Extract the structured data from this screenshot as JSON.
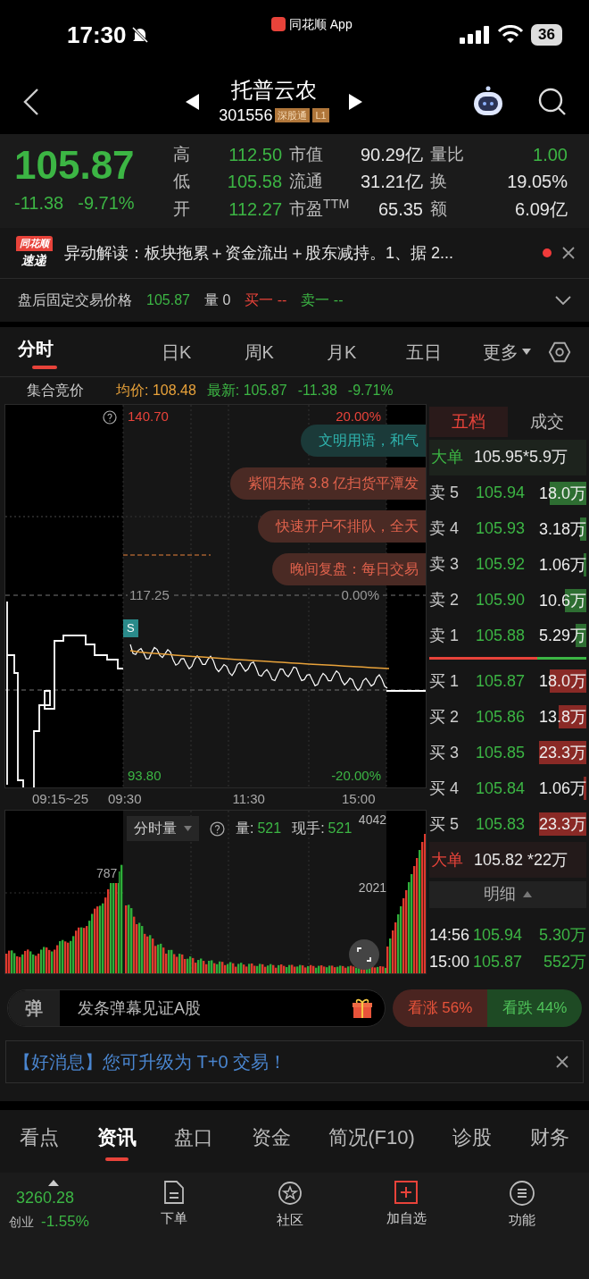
{
  "status_bar": {
    "time": "17:30",
    "app_label": "同花顺 App",
    "battery": "36",
    "muted": true
  },
  "header": {
    "name": "托普云农",
    "code": "301556",
    "tags": [
      "深股通",
      "L1"
    ]
  },
  "quote": {
    "price": "105.87",
    "change": "-11.38",
    "change_pct": "-9.71%",
    "stats": [
      {
        "label": "高",
        "value": "112.50",
        "color": "#3cb544"
      },
      {
        "label": "市值",
        "value": "90.29亿",
        "color": "#e6e6e6"
      },
      {
        "label": "量比",
        "value": "1.00",
        "color": "#3cb544"
      },
      {
        "label": "低",
        "value": "105.58",
        "color": "#3cb544"
      },
      {
        "label": "流通",
        "value": "31.21亿",
        "color": "#e6e6e6"
      },
      {
        "label": "换",
        "value": "19.05%",
        "color": "#e6e6e6"
      },
      {
        "label": "开",
        "value": "112.27",
        "color": "#3cb544"
      },
      {
        "label": "市盈$^{TTM}$",
        "value": "65.35",
        "color": "#e6e6e6"
      },
      {
        "label": "额",
        "value": "6.09亿",
        "color": "#e6e6e6"
      }
    ]
  },
  "news": {
    "badge_top": "同花顺",
    "badge_bottom": "速递",
    "text": "异动解读：板块拖累＋资金流出＋股东减持。1、据 2...",
    "unread": true
  },
  "after_hours": {
    "label": "盘后固定交易价格",
    "price": "105.87",
    "volume": "量 0",
    "bid": "买一 --",
    "ask": "卖一 --"
  },
  "chart_tabs": [
    {
      "label": "分时",
      "selected": true
    },
    {
      "label": "日K",
      "selected": false
    },
    {
      "label": "周K",
      "selected": false
    },
    {
      "label": "月K",
      "selected": false
    },
    {
      "label": "五日",
      "selected": false
    },
    {
      "label": "更多",
      "selected": false
    }
  ],
  "info_line": {
    "label": "集合竞价",
    "avg": "均价: 108.48",
    "latest": "最新: 105.87",
    "change": "-11.38",
    "change_pct": "-9.71%"
  },
  "price_chart": {
    "top_price": "140.70",
    "top_pct": "20.00%",
    "mid_price": "117.25",
    "mid_pct": "0.00%",
    "bottom_price": "93.80",
    "bottom_pct": "-20.00%",
    "times": [
      "09:15~25",
      "09:30",
      "11:30",
      "15:00"
    ],
    "marker": "S",
    "danmaku": [
      {
        "text": "文明用语，和气",
        "kind": "notice"
      },
      {
        "text": "紫阳东路 3.8 亿扫货平潭发",
        "kind": "promo"
      },
      {
        "text": "快速开户不排队，全天",
        "kind": "promo"
      },
      {
        "text": "晚间复盘：每日交易",
        "kind": "promo"
      }
    ]
  },
  "volume_chart": {
    "selector": "分时量",
    "volume_label": "量:",
    "volume": "521",
    "hand_label": "现手:",
    "hand": "521",
    "top_tick": "4042",
    "mid_tick": "2021",
    "auction_tick": "787"
  },
  "order_book": {
    "tabs": [
      {
        "label": "五档",
        "selected": true
      },
      {
        "label": "成交",
        "selected": false
      }
    ],
    "big_sell": {
      "label": "大单",
      "value": "105.95*5.9万"
    },
    "asks": [
      {
        "label": "卖 5",
        "price": "105.94",
        "volume": "18.0万"
      },
      {
        "label": "卖 4",
        "price": "105.93",
        "volume": "3.18万"
      },
      {
        "label": "卖 3",
        "price": "105.92",
        "volume": "1.06万"
      },
      {
        "label": "卖 2",
        "price": "105.90",
        "volume": "10.6万"
      },
      {
        "label": "卖 1",
        "price": "105.88",
        "volume": "5.29万"
      }
    ],
    "bids": [
      {
        "label": "买 1",
        "price": "105.87",
        "volume": "18.0万"
      },
      {
        "label": "买 2",
        "price": "105.86",
        "volume": "13.8万"
      },
      {
        "label": "买 3",
        "price": "105.85",
        "volume": "23.3万"
      },
      {
        "label": "买 4",
        "price": "105.84",
        "volume": "1.06万"
      },
      {
        "label": "买 5",
        "price": "105.83",
        "volume": "23.3万"
      }
    ],
    "big_buy": {
      "label": "大单",
      "value": "105.82 *22万"
    },
    "detail_button": "明细",
    "trades": [
      {
        "time": "14:56",
        "price": "105.94",
        "volume": "5.30万"
      },
      {
        "time": "15:00",
        "price": "105.87",
        "volume": "552万"
      }
    ]
  },
  "danmaku_bar": {
    "icon_char": "弹",
    "placeholder": "发条弹幕见证A股",
    "bull": "看涨 56%",
    "bear": "看跌 44%"
  },
  "banner": {
    "text": "【好消息】您可升级为 T+0 交易！"
  },
  "bottom_tabs": [
    {
      "label": "看点",
      "selected": false
    },
    {
      "label": "资讯",
      "selected": true
    },
    {
      "label": "盘口",
      "selected": false
    },
    {
      "label": "资金",
      "selected": false
    },
    {
      "label": "简况(F10)",
      "selected": false
    },
    {
      "label": "诊股",
      "selected": false
    },
    {
      "label": "财务",
      "selected": false
    }
  ],
  "index": {
    "value": "3260.28",
    "name": "创业",
    "change": "-1.55%"
  },
  "bottom_nav": [
    {
      "label": "下单",
      "kind": "order"
    },
    {
      "label": "社区",
      "kind": "community"
    },
    {
      "label": "加自选",
      "kind": "add"
    },
    {
      "label": "功能",
      "kind": "menu"
    }
  ]
}
